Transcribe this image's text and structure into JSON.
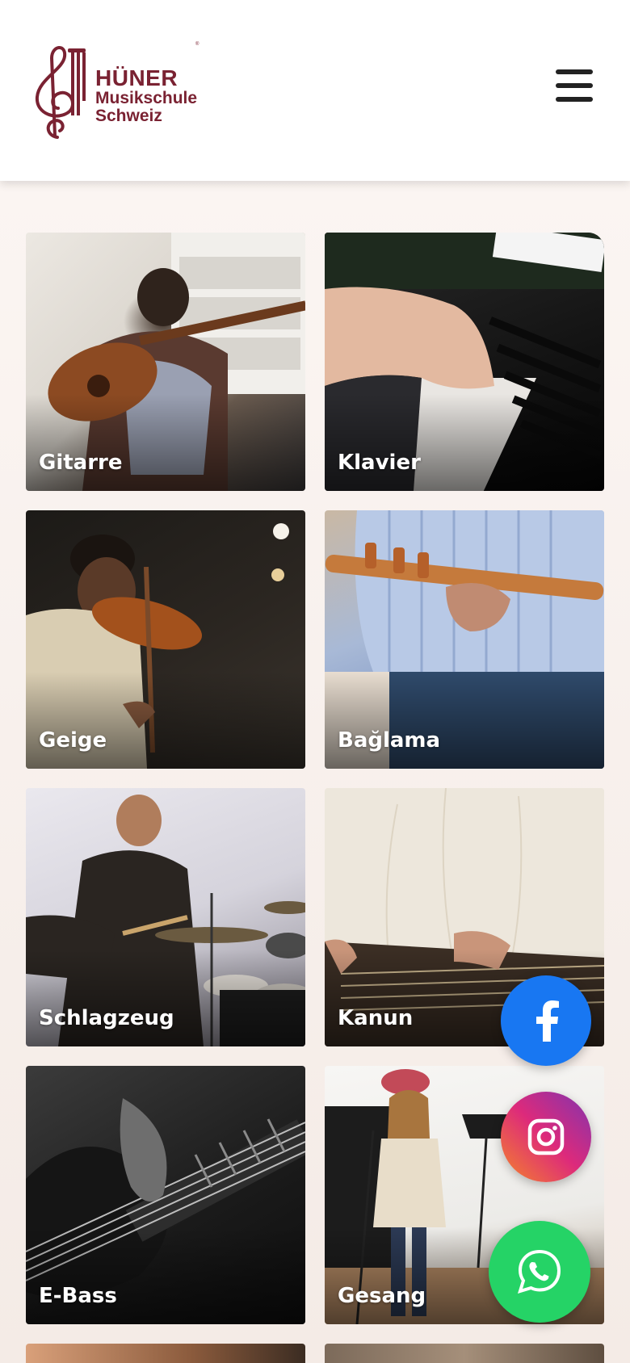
{
  "brand": {
    "title": "HÜNER",
    "subtitle_line1": "Musikschule",
    "subtitle_line2": "Schweiz",
    "trademark": "®",
    "color": "#7a2232"
  },
  "header": {
    "menu_icon": "hamburger-menu-icon"
  },
  "instruments": [
    {
      "label": "Gitarre"
    },
    {
      "label": "Klavier"
    },
    {
      "label": "Geige"
    },
    {
      "label": "Bağlama"
    },
    {
      "label": "Schlagzeug"
    },
    {
      "label": "Kanun"
    },
    {
      "label": "E-Bass"
    },
    {
      "label": "Gesang"
    }
  ],
  "social": {
    "facebook": {
      "icon": "facebook-icon",
      "color": "#1877f2"
    },
    "instagram": {
      "icon": "instagram-icon",
      "color": "#d6249f"
    },
    "whatsapp": {
      "icon": "whatsapp-icon",
      "color": "#25d366"
    }
  }
}
